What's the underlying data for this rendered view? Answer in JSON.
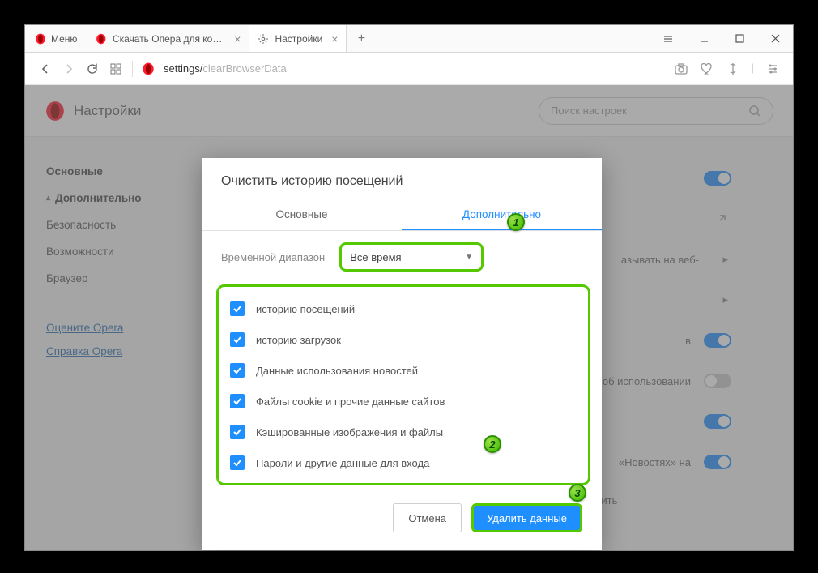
{
  "titlebar": {
    "menu_label": "Меню",
    "tabs": [
      {
        "label": "Скачать Опера для компь"
      },
      {
        "label": "Настройки"
      }
    ]
  },
  "address": {
    "prefix": "settings/",
    "path": "clearBrowserData"
  },
  "page": {
    "title": "Настройки",
    "search_placeholder": "Поиск настроек"
  },
  "sidebar": {
    "items": [
      {
        "label": "Основные",
        "bold": true
      },
      {
        "label": "Дополнительно",
        "bold": true,
        "expand": true
      },
      {
        "label": "Безопасность"
      },
      {
        "label": "Возможности"
      },
      {
        "label": "Браузер"
      }
    ],
    "links": [
      {
        "label": "Оцените Opera"
      },
      {
        "label": "Справка Opera"
      }
    ]
  },
  "bg_rows": [
    {
      "text": "",
      "kind": "toggle-on"
    },
    {
      "text": "",
      "kind": "ext"
    },
    {
      "text": "азывать на веб-",
      "kind": "arrow"
    },
    {
      "text": "",
      "kind": "arrow"
    },
    {
      "text": "в",
      "kind": "toggle-on"
    },
    {
      "text": "об использовании",
      "kind": "toggle-off"
    },
    {
      "text": "",
      "kind": "toggle-on"
    },
    {
      "text": "«Новостях» на",
      "kind": "toggle-on"
    },
    {
      "text": "Отправлять данные об использовании новостей, чтобы улучшить персонализацию",
      "kind": "none"
    }
  ],
  "dialog": {
    "title": "Очистить историю посещений",
    "tab_basic": "Основные",
    "tab_advanced": "Дополнительно",
    "time_label": "Временной диапазон",
    "time_value": "Все время",
    "checks": [
      "историю посещений",
      "историю загрузок",
      "Данные использования новостей",
      "Файлы cookie и прочие данные сайтов",
      "Кэшированные изображения и файлы",
      "Пароли и другие данные для входа"
    ],
    "cancel": "Отмена",
    "delete": "Удалить данные"
  },
  "badges": {
    "b1": "1",
    "b2": "2",
    "b3": "3"
  }
}
